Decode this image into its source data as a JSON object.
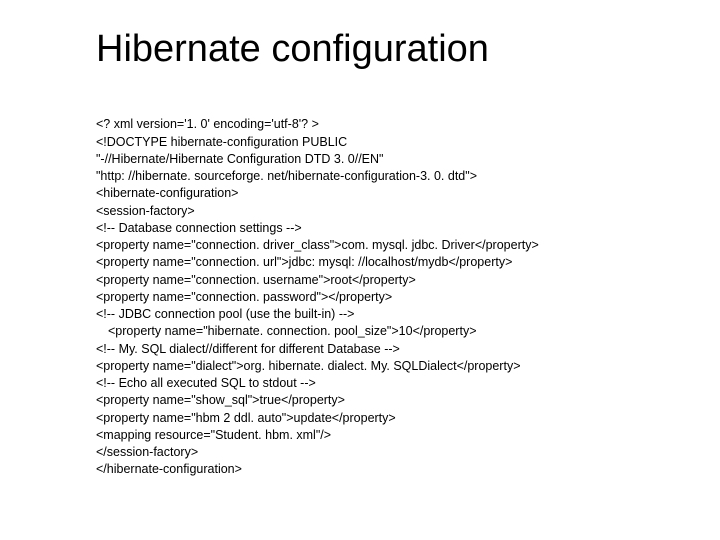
{
  "title": "Hibernate configuration",
  "code": {
    "l01": "<? xml version='1. 0' encoding='utf-8'? >",
    "l02": "<!DOCTYPE hibernate-configuration PUBLIC",
    "l03": "\"-//Hibernate/Hibernate Configuration DTD 3. 0//EN\"",
    "l04": "\"http: //hibernate. sourceforge. net/hibernate-configuration-3. 0. dtd\">",
    "l05": "<hibernate-configuration>",
    "l06": "<session-factory>",
    "l07": "<!-- Database connection settings -->",
    "l08": "<property name=\"connection. driver_class\">com. mysql. jdbc. Driver</property>",
    "l09": "<property name=\"connection. url\">jdbc: mysql: //localhost/mydb</property>",
    "l10": "<property name=\"connection. username\">root</property>",
    "l11": "<property name=\"connection. password\"></property>",
    "l12": "<!-- JDBC connection pool (use the built-in) -->",
    "l13": "<property name=\"hibernate. connection. pool_size\">10</property>",
    "l14": "<!-- My. SQL dialect//different for different Database -->",
    "l15": "<property name=\"dialect\">org. hibernate. dialect. My. SQLDialect</property>",
    "l16": "<!-- Echo all executed SQL to stdout -->",
    "l17": "<property name=\"show_sql\">true</property>",
    "l18": "<property name=\"hbm 2 ddl. auto\">update</property>",
    "l19": "<mapping resource=\"Student. hbm. xml\"/>",
    "l20": "</session-factory>",
    "l21": "</hibernate-configuration>"
  }
}
